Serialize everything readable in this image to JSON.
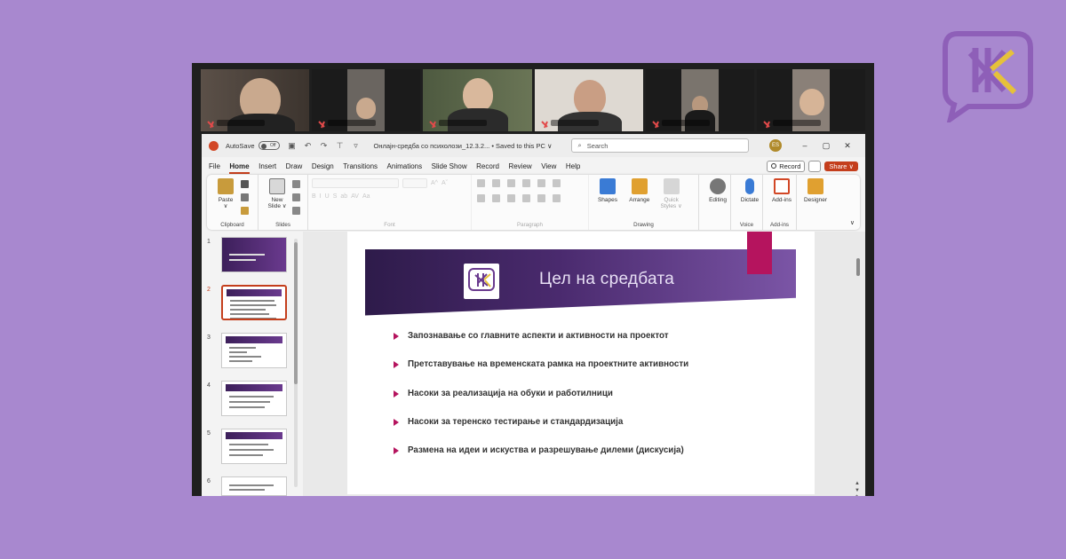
{
  "brand": {
    "accent": "#8e5fb8",
    "accent2": "#e6c13a",
    "icon": "letter-logo-icon"
  },
  "window": {
    "autosave_label": "AutoSave",
    "autosave_state": "Off",
    "doc_title": "Онлајн-средба со психолози_12.3.2... • Saved to this PC ∨",
    "search_placeholder": "Search",
    "avatar_initials": "ES",
    "min": "–",
    "max": "▢",
    "close": "✕"
  },
  "menu": {
    "tabs": [
      "File",
      "Home",
      "Insert",
      "Draw",
      "Design",
      "Transitions",
      "Animations",
      "Slide Show",
      "Record",
      "Review",
      "View",
      "Help"
    ],
    "active": "Home",
    "record_label": "Record",
    "share_label": "Share ∨"
  },
  "ribbon": {
    "paste": "Paste",
    "paste_caret": "∨",
    "clipboard": "Clipboard",
    "new_slide": "New",
    "new_slide2": "Slide ∨",
    "slides": "Slides",
    "font": "Font",
    "paragraph": "Paragraph",
    "shapes": "Shapes",
    "arrange": "Arrange",
    "quick_styles": "Quick",
    "quick_styles2": "Styles ∨",
    "drawing": "Drawing",
    "editing": "Editing",
    "dictate": "Dictate",
    "voice": "Voice",
    "addins": "Add-ins",
    "addins_group": "Add-ins",
    "designer": "Designer",
    "font_tools": [
      "B",
      "I",
      "U",
      "S",
      "ab",
      "AV",
      "Aa"
    ],
    "grow": "A^",
    "shrink": "Aˇ",
    "collapse": "∨"
  },
  "thumbs": [
    "1",
    "2",
    "3",
    "4",
    "5",
    "6"
  ],
  "slide": {
    "title": "Цел на средбата",
    "bullets": [
      "Запознавање со главните аспекти и активности на проектот",
      "Претставување на временската рамка на проектните активности",
      "Насоки за реализација на обуки и работилници",
      "Насоки за теренско тестирање и стандардизација",
      "Размена на идеи и искуства и разрешување дилеми (дискусија)"
    ],
    "banner_color": "#3c1f5a",
    "bullet_color": "#b5145e"
  },
  "scroll_arrows": "▲\n▼"
}
